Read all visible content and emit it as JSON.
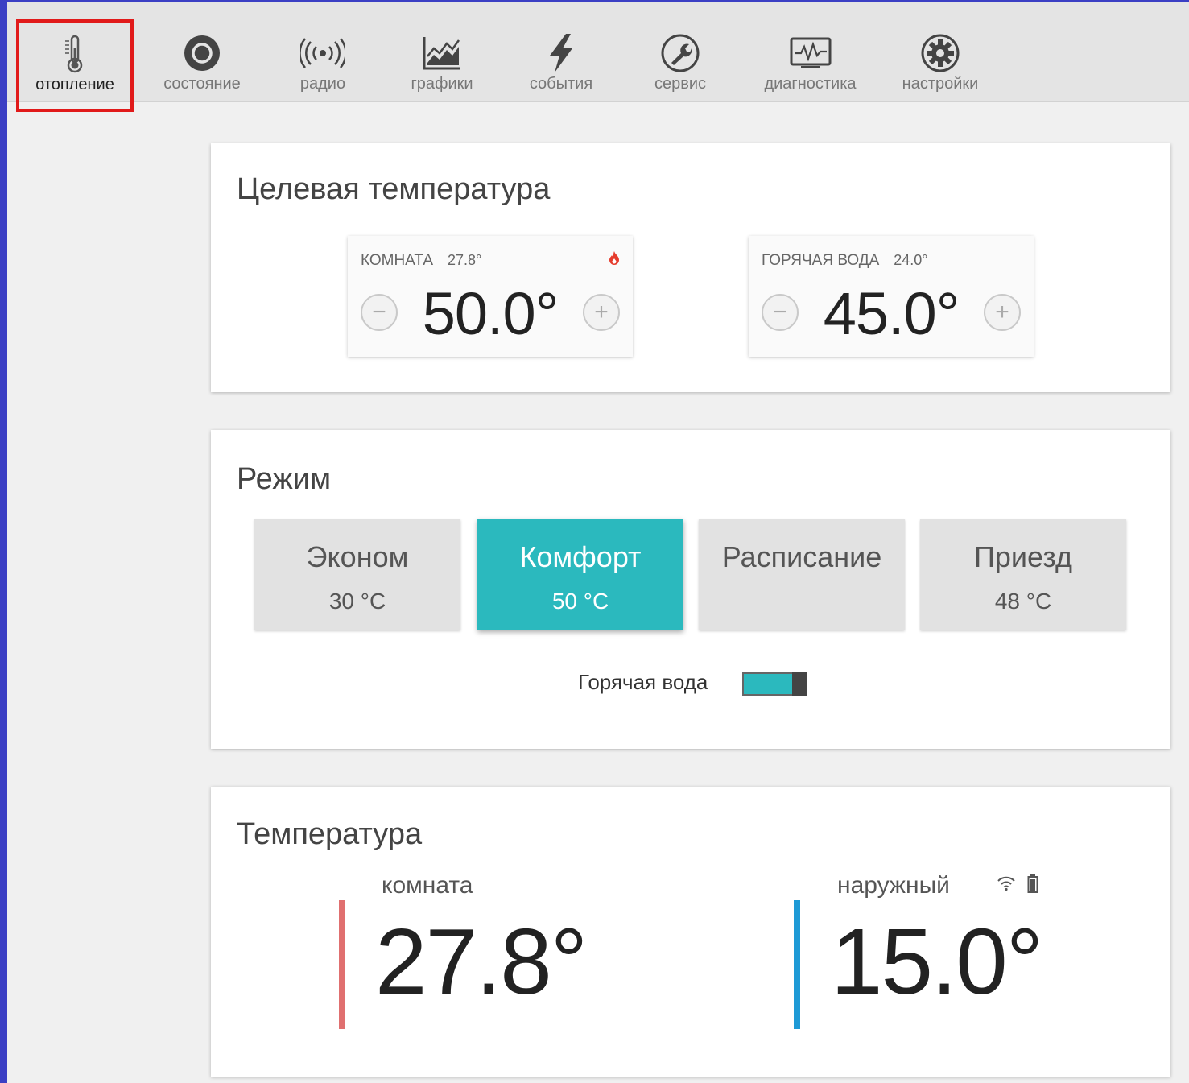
{
  "nav": {
    "items": [
      {
        "label": "отопление",
        "icon": "thermometer-icon",
        "active": true
      },
      {
        "label": "состояние",
        "icon": "circle-status-icon"
      },
      {
        "label": "радио",
        "icon": "radio-waves-icon"
      },
      {
        "label": "графики",
        "icon": "chart-icon"
      },
      {
        "label": "события",
        "icon": "lightning-icon"
      },
      {
        "label": "сервис",
        "icon": "wrench-icon"
      },
      {
        "label": "диагностика",
        "icon": "pulse-monitor-icon"
      },
      {
        "label": "настройки",
        "icon": "gear-icon"
      }
    ],
    "active_outline_color": "#e11a1a"
  },
  "target": {
    "title": "Целевая температура",
    "room": {
      "label": "КОМНАТА",
      "current": "27.8°",
      "value": "50.0°",
      "icon": "flame-icon"
    },
    "water": {
      "label": "ГОРЯЧАЯ ВОДА",
      "current": "24.0°",
      "value": "45.0°"
    }
  },
  "mode": {
    "title": "Режим",
    "options": [
      {
        "name": "Эконом",
        "temp": "30 °C"
      },
      {
        "name": "Комфорт",
        "temp": "50 °C",
        "active": true
      },
      {
        "name": "Расписание",
        "temp": ""
      },
      {
        "name": "Приезд",
        "temp": "48 °C"
      }
    ],
    "hot_water_label": "Горячая вода",
    "hot_water_on": true,
    "accent": "#2bb9be"
  },
  "temperature": {
    "title": "Температура",
    "room": {
      "label": "комната",
      "value": "27.8°",
      "color": "#e07070"
    },
    "outside": {
      "label": "наружный",
      "value": "15.0°",
      "color": "#1e9ad6",
      "icons": [
        "wifi-icon",
        "battery-icon"
      ]
    }
  }
}
